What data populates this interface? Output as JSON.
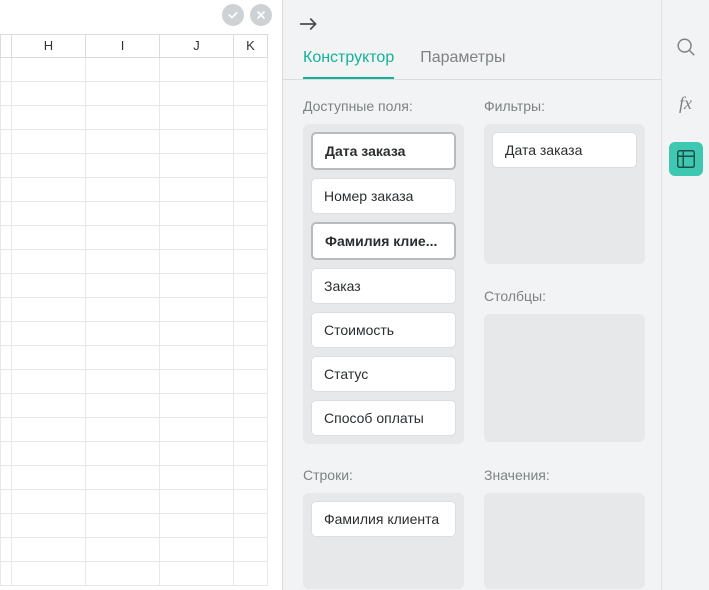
{
  "sheet": {
    "columns": [
      "",
      "H",
      "I",
      "J",
      "K"
    ],
    "row_count": 22
  },
  "panel": {
    "tabs": {
      "constructor": "Конструктор",
      "params": "Параметры"
    },
    "active_tab": "constructor",
    "labels": {
      "available": "Доступные поля:",
      "filters": "Фильтры:",
      "columns": "Столбцы:",
      "rows": "Строки:",
      "values": "Значения:"
    },
    "available_fields": [
      {
        "label": "Дата заказа",
        "bold": true
      },
      {
        "label": "Номер заказа",
        "bold": false
      },
      {
        "label": "Фамилия клие...",
        "bold": true
      },
      {
        "label": "Заказ",
        "bold": false
      },
      {
        "label": "Стоимость",
        "bold": false
      },
      {
        "label": "Статус",
        "bold": false
      },
      {
        "label": "Способ оплаты",
        "bold": false
      }
    ],
    "filters": [
      {
        "label": "Дата заказа"
      }
    ],
    "columns": [],
    "rows": [
      {
        "label": "Фамилия клиента"
      }
    ],
    "values": []
  },
  "strip": {
    "tools": [
      "search",
      "fx",
      "pivot"
    ],
    "active_tool": "pivot"
  }
}
